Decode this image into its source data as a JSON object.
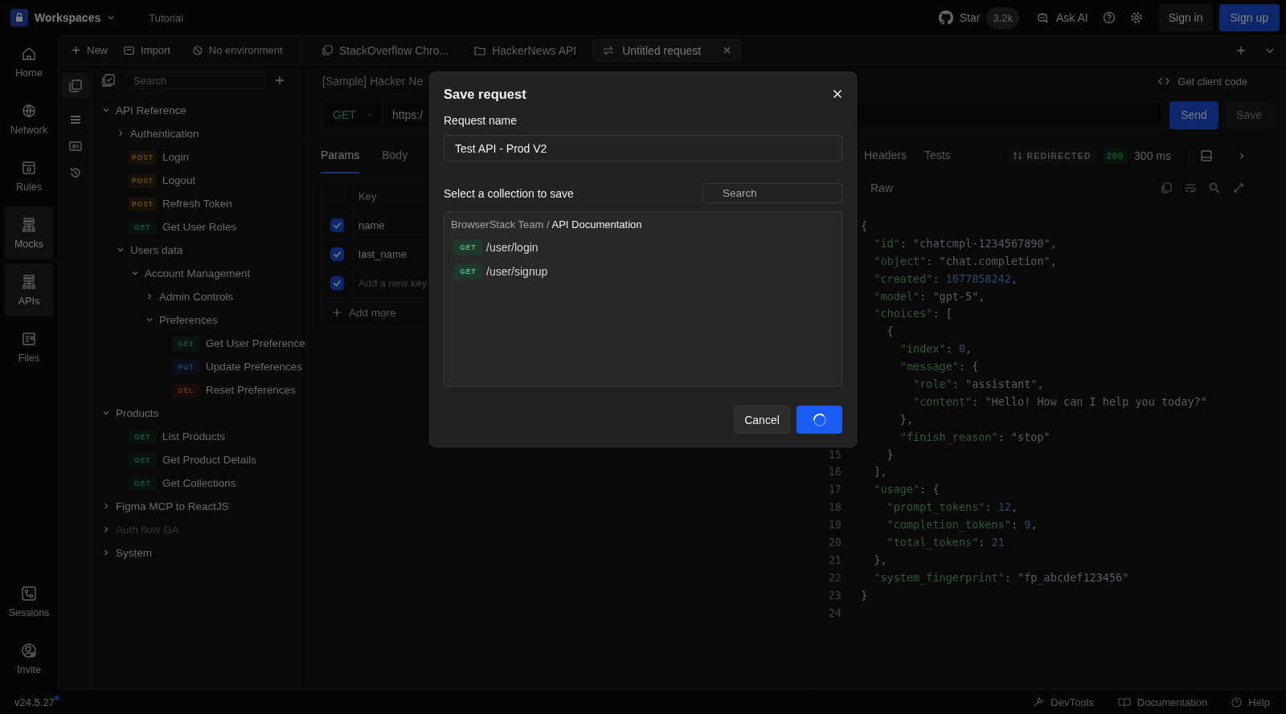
{
  "top_bar": {
    "workspace": "Workspaces",
    "tutorial": "Tutorial",
    "github_star": "Star",
    "star_count": "3.2k",
    "ask_ai": "Ask AI",
    "sign_in": "Sign in",
    "sign_up": "Sign up"
  },
  "rail": {
    "items": [
      {
        "label": "Home",
        "selected": false
      },
      {
        "label": "Network",
        "selected": false
      },
      {
        "label": "Rules",
        "selected": false
      },
      {
        "label": "Mocks",
        "selected": true
      },
      {
        "label": "APIs",
        "selected": true
      },
      {
        "label": "Files",
        "selected": false
      }
    ],
    "bottom_items": [
      {
        "label": "Sessions"
      },
      {
        "label": "Invite"
      }
    ]
  },
  "toolbar": {
    "new": "New",
    "import": "Import",
    "environment": "No environment"
  },
  "tabs": [
    {
      "label": "StackOverflow Chro...",
      "selected": false,
      "kind": "collection"
    },
    {
      "label": "HackerNews API",
      "selected": false,
      "kind": "folder"
    },
    {
      "label": "Untitled request",
      "selected": true,
      "kind": "request"
    }
  ],
  "sidebar": {
    "search_placeholder": "Search",
    "tree": [
      {
        "kind": "folder",
        "label": "API Reference",
        "expanded": true,
        "disabled": false,
        "children": [
          {
            "kind": "folder",
            "label": "Authentication",
            "expanded": false,
            "disabled": false
          },
          {
            "kind": "request",
            "method": "POST",
            "label": "Login"
          },
          {
            "kind": "request",
            "method": "POST",
            "label": "Logout"
          },
          {
            "kind": "request",
            "method": "POST",
            "label": "Refresh Token"
          },
          {
            "kind": "request",
            "method": "GET",
            "label": "Get User Roles"
          },
          {
            "kind": "folder",
            "label": "Users data",
            "expanded": true,
            "disabled": false,
            "children": [
              {
                "kind": "folder",
                "label": "Account Management",
                "expanded": true,
                "disabled": false,
                "children": [
                  {
                    "kind": "folder",
                    "label": "Admin Controls",
                    "expanded": false,
                    "disabled": false
                  },
                  {
                    "kind": "folder",
                    "label": "Preferences",
                    "expanded": true,
                    "disabled": false,
                    "children": [
                      {
                        "kind": "request",
                        "method": "GET",
                        "label": "Get User Preference"
                      },
                      {
                        "kind": "request",
                        "method": "PUT",
                        "label": "Update Preferences"
                      },
                      {
                        "kind": "request",
                        "method": "DEL",
                        "label": "Reset Preferences"
                      }
                    ]
                  }
                ]
              }
            ]
          }
        ]
      },
      {
        "kind": "folder",
        "label": "Products",
        "expanded": true,
        "disabled": false,
        "children": [
          {
            "kind": "request",
            "method": "GET",
            "label": "List Products"
          },
          {
            "kind": "request",
            "method": "GET",
            "label": "Get Product Details"
          },
          {
            "kind": "request",
            "method": "GET",
            "label": "Get Collections"
          }
        ]
      },
      {
        "kind": "folder",
        "label": "Figma MCP to ReactJS",
        "expanded": false,
        "disabled": false
      },
      {
        "kind": "folder",
        "label": "Auth flow GA",
        "expanded": false,
        "disabled": true
      },
      {
        "kind": "folder",
        "label": "System",
        "expanded": false,
        "disabled": false
      }
    ]
  },
  "request": {
    "breadcrumb": "[Sample] Hacker Ne",
    "method": "GET",
    "url": "https:/",
    "client_code": "Get client code",
    "send": "Send",
    "save": "Save",
    "save_disabled": true,
    "tabs": [
      {
        "label": "Params",
        "selected": true
      },
      {
        "label": "Body",
        "selected": false
      }
    ],
    "params": {
      "column": "Key",
      "rows": [
        {
          "key": "name",
          "checked": true
        },
        {
          "key": "last_name",
          "checked": true
        }
      ],
      "new_row": {
        "placeholder": "Add a new key",
        "checked": true
      },
      "add_more": "Add more"
    }
  },
  "response": {
    "tabs": [
      {
        "label": "Headers",
        "selected": false
      },
      {
        "label": "Tests",
        "selected": false
      }
    ],
    "redirected": "REDIRECTED",
    "status": "200",
    "time": "300 ms",
    "view": "Raw",
    "lines": [
      {
        "text": "{"
      },
      {
        "text": "  \"id\": \"chatcmpl-1234567890\","
      },
      {
        "text": "  \"object\": \"chat.completion\","
      },
      {
        "text": "  \"created\": 1677858242,"
      },
      {
        "text": "  \"model\": \"gpt-5\","
      },
      {
        "text": "  \"choices\": ["
      },
      {
        "text": "    {"
      },
      {
        "text": "      \"index\": 0,"
      },
      {
        "text": "      \"message\": {"
      },
      {
        "text": "        \"role\": \"assistant\","
      },
      {
        "text": "        \"content\": \"Hello! How can I help you today?\""
      },
      {
        "text": "      },"
      },
      {
        "text": "      \"finish_reason\": \"stop\""
      },
      {
        "number": "15",
        "text": "    }"
      },
      {
        "number": "16",
        "text": "  ],"
      },
      {
        "number": "17",
        "text": "  \"usage\": {"
      },
      {
        "number": "18",
        "text": "    \"prompt_tokens\": 12,"
      },
      {
        "number": "19",
        "text": "    \"completion_tokens\": 9,"
      },
      {
        "number": "20",
        "text": "    \"total_tokens\": 21"
      },
      {
        "number": "21",
        "text": "  },"
      },
      {
        "number": "22",
        "text": "  \"system_fingerprint\": \"fp_abcdef123456\""
      },
      {
        "number": "23",
        "text": "}"
      },
      {
        "number": "24"
      }
    ]
  },
  "status_bar": {
    "version": "v24.5.27",
    "update_dot": true,
    "devtools": "DevTools",
    "documentation": "Documentation",
    "help": "Help"
  },
  "modal": {
    "title": "Save request",
    "name_label": "Request name",
    "name_value": "Test API - Prod V2",
    "collection_label": "Select a collection to save",
    "search_placeholder": "Search",
    "path_team": "BrowserStack Team /",
    "path_collection": "API Documentation",
    "items": [
      {
        "method": "GET",
        "path": "/user/login"
      },
      {
        "method": "GET",
        "path": "/user/signup"
      }
    ],
    "cancel": "Cancel",
    "loading": true
  }
}
